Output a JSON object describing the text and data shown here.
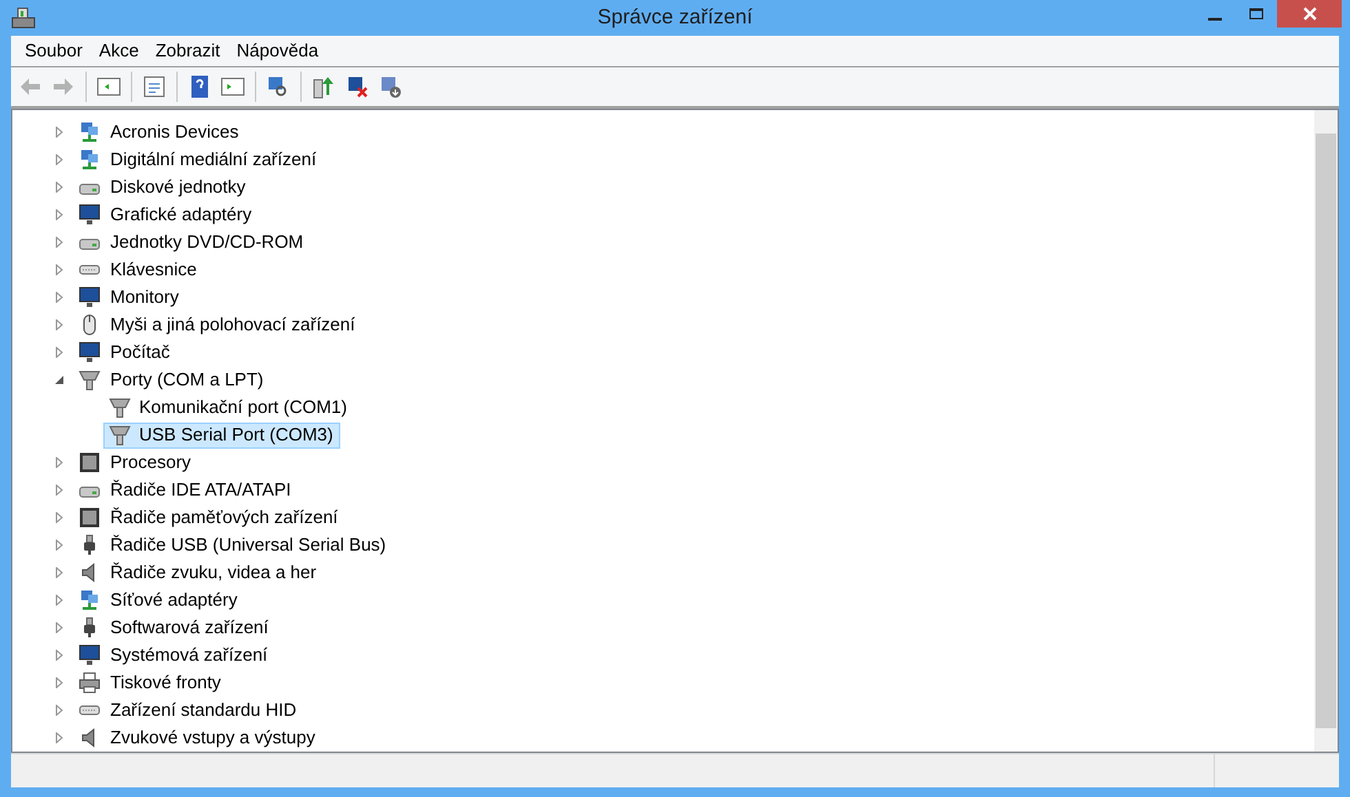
{
  "window": {
    "title": "Správce zařízení"
  },
  "menu": [
    "Soubor",
    "Akce",
    "Zobrazit",
    "Nápověda"
  ],
  "tree": [
    {
      "label": "Acronis Devices",
      "expanded": false,
      "kind": "network"
    },
    {
      "label": "Digitální mediální zařízení",
      "expanded": false,
      "kind": "network"
    },
    {
      "label": "Diskové jednotky",
      "expanded": false,
      "kind": "drive"
    },
    {
      "label": "Grafické adaptéry",
      "expanded": false,
      "kind": "monitor"
    },
    {
      "label": "Jednotky DVD/CD-ROM",
      "expanded": false,
      "kind": "drive"
    },
    {
      "label": "Klávesnice",
      "expanded": false,
      "kind": "keyboard"
    },
    {
      "label": "Monitory",
      "expanded": false,
      "kind": "monitor"
    },
    {
      "label": "Myši a jiná polohovací zařízení",
      "expanded": false,
      "kind": "mouse"
    },
    {
      "label": "Počítač",
      "expanded": false,
      "kind": "monitor"
    },
    {
      "label": "Porty (COM a LPT)",
      "expanded": true,
      "kind": "port",
      "children": [
        {
          "label": "Komunikační port (COM1)",
          "selected": false,
          "kind": "port"
        },
        {
          "label": "USB Serial Port (COM3)",
          "selected": true,
          "kind": "port"
        }
      ]
    },
    {
      "label": "Procesory",
      "expanded": false,
      "kind": "chip"
    },
    {
      "label": "Řadiče IDE ATA/ATAPI",
      "expanded": false,
      "kind": "drive"
    },
    {
      "label": "Řadiče paměťových zařízení",
      "expanded": false,
      "kind": "chip"
    },
    {
      "label": "Řadiče USB (Universal Serial Bus)",
      "expanded": false,
      "kind": "usb"
    },
    {
      "label": "Řadiče zvuku, videa a her",
      "expanded": false,
      "kind": "speaker"
    },
    {
      "label": "Síťové adaptéry",
      "expanded": false,
      "kind": "network"
    },
    {
      "label": "Softwarová zařízení",
      "expanded": false,
      "kind": "usb"
    },
    {
      "label": "Systémová zařízení",
      "expanded": false,
      "kind": "monitor"
    },
    {
      "label": "Tiskové fronty",
      "expanded": false,
      "kind": "printer"
    },
    {
      "label": "Zařízení standardu HID",
      "expanded": false,
      "kind": "keyboard"
    },
    {
      "label": "Zvukové vstupy a výstupy",
      "expanded": false,
      "kind": "speaker"
    }
  ]
}
